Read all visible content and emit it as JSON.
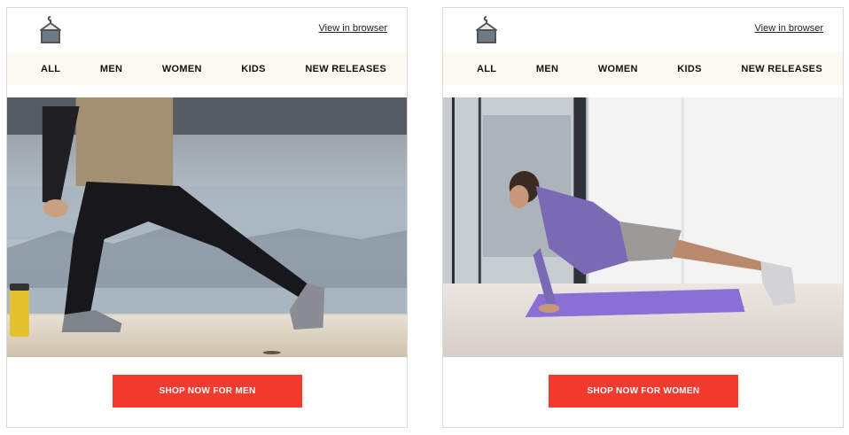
{
  "men_email": {
    "view_link": "View in browser",
    "nav": [
      "ALL",
      "MEN",
      "WOMEN",
      "KIDS",
      "NEW RELEASES"
    ],
    "cta": "SHOP NOW FOR MEN",
    "colors": {
      "nav_bg": "#fbfaf1",
      "cta_bg": "#f23a2e"
    }
  },
  "women_email": {
    "view_link": "View in browser",
    "nav": [
      "ALL",
      "MEN",
      "WOMEN",
      "KIDS",
      "NEW RELEASES"
    ],
    "cta": "SHOP NOW FOR WOMEN",
    "colors": {
      "nav_bg": "#fbfaf1",
      "cta_bg": "#f23a2e"
    }
  }
}
